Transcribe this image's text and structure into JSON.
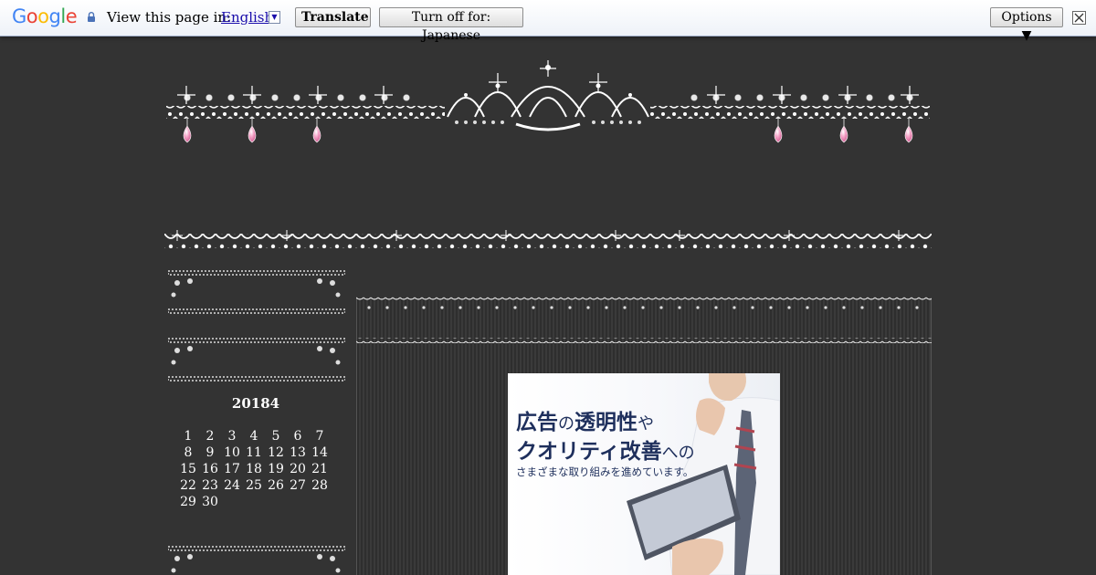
{
  "translate_bar": {
    "logo": [
      "G",
      "o",
      "o",
      "g",
      "l",
      "e"
    ],
    "logo_colors": [
      "#4285f4",
      "#ea4335",
      "#fbbc05",
      "#4285f4",
      "#34a853",
      "#ea4335"
    ],
    "lock_icon": "lock-icon",
    "view_label": "View this page in:",
    "language": "English",
    "translate_label": "Translate",
    "turn_off_label": "Turn off for: Japanese",
    "options_label": "Options ▼",
    "close_icon": "close-icon"
  },
  "sidebar": {
    "calendar": {
      "title": "20184",
      "days": [
        "1",
        "2",
        "3",
        "4",
        "5",
        "6",
        "7",
        "8",
        "9",
        "10",
        "11",
        "12",
        "13",
        "14",
        "15",
        "16",
        "17",
        "18",
        "19",
        "20",
        "21",
        "22",
        "23",
        "24",
        "25",
        "26",
        "27",
        "28",
        "29",
        "30"
      ]
    }
  },
  "ad": {
    "line1": [
      "広告",
      "の",
      "透明性",
      "や"
    ],
    "line2": [
      "クオリティ改善",
      "への"
    ],
    "line3": "さまざまな取り組みを進めています。",
    "text_color": "#1e2f5c"
  },
  "colors": {
    "background": "#333333",
    "jewel_pink": "#f5a3c7"
  }
}
